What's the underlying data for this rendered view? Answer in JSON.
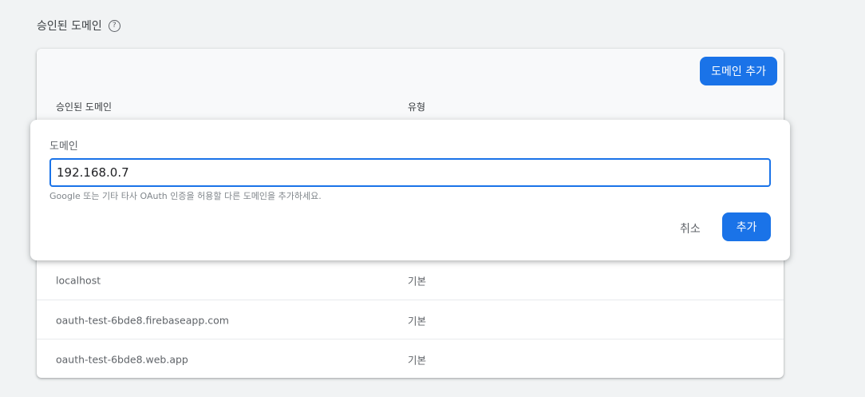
{
  "section": {
    "title": "승인된 도메인",
    "help_icon": "?"
  },
  "card": {
    "add_button_label": "도메인 추가",
    "columns": {
      "domain": "승인된 도메인",
      "type": "유형"
    },
    "rows": [
      {
        "domain": "localhost",
        "type": "기본"
      },
      {
        "domain": "oauth-test-6bde8.firebaseapp.com",
        "type": "기본"
      },
      {
        "domain": "oauth-test-6bde8.web.app",
        "type": "기본"
      }
    ]
  },
  "dialog": {
    "label": "도메인",
    "input_value": "192.168.0.7",
    "hint": "Google 또는 기타 타사 OAuth 인증을 허용할 다른 도메인을 추가하세요.",
    "cancel_label": "취소",
    "submit_label": "추가"
  },
  "colors": {
    "accent": "#1a73e8",
    "background": "#f1f3f4"
  }
}
